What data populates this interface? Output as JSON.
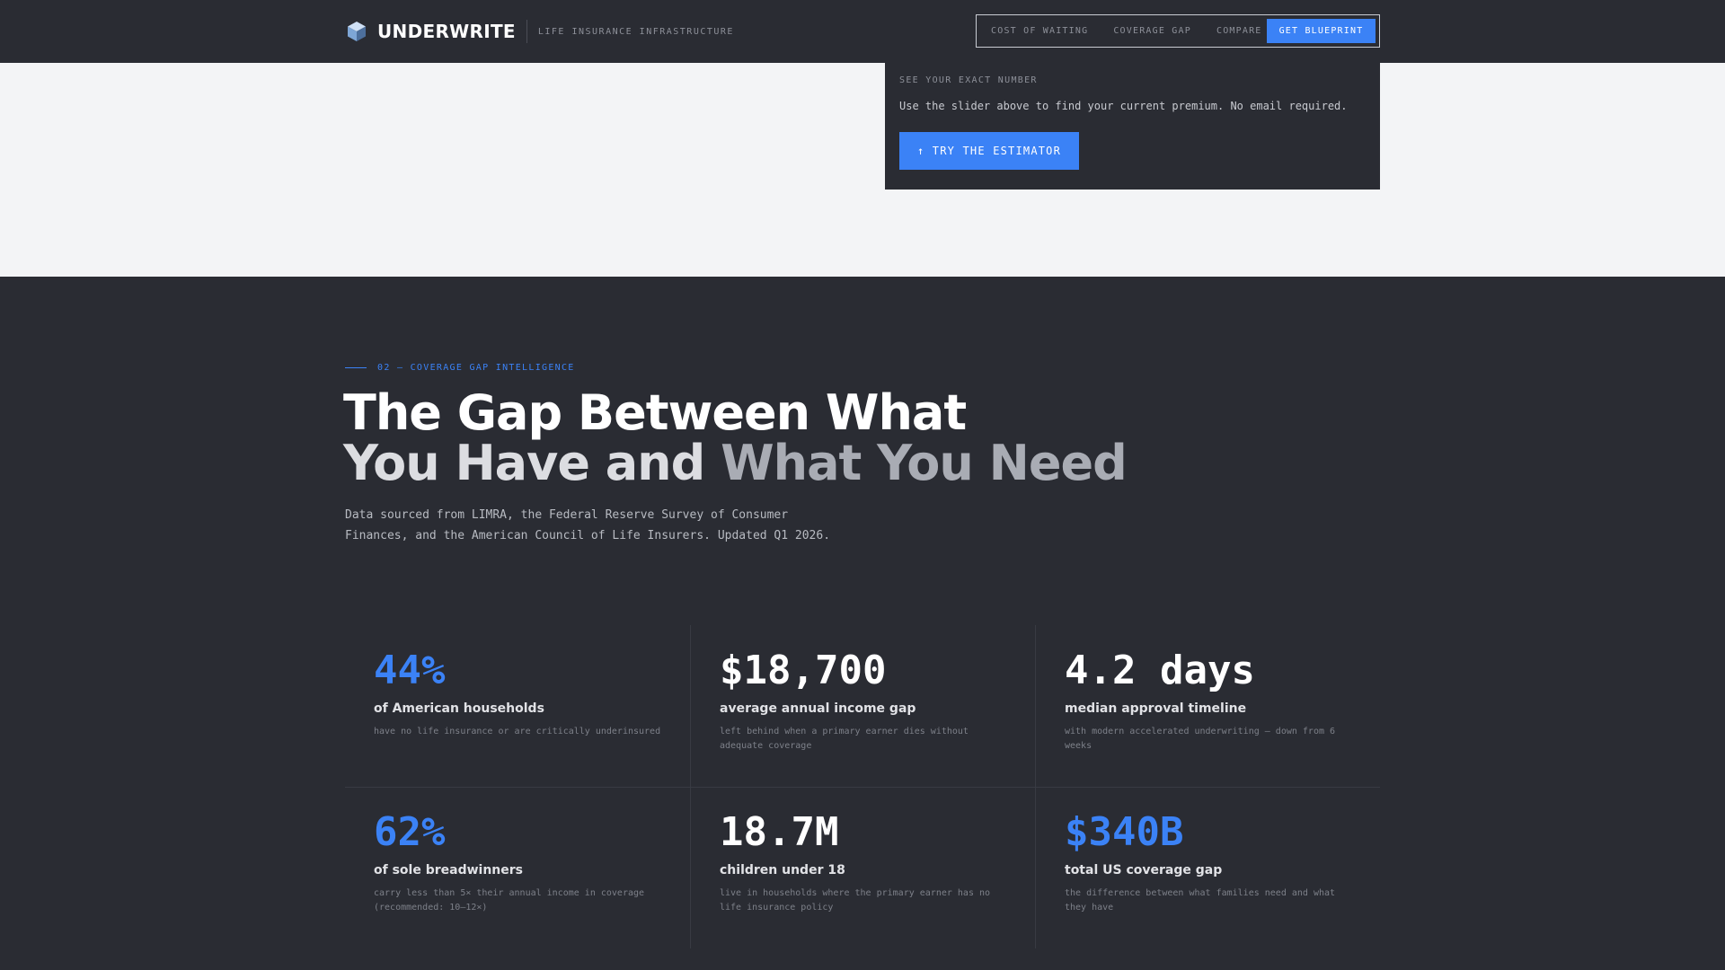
{
  "header": {
    "brand": "UNDERWRITE",
    "tagline": "LIFE INSURANCE INFRASTRUCTURE",
    "nav": [
      "COST OF WAITING",
      "COVERAGE GAP",
      "COMPARE"
    ],
    "cta": "GET BLUEPRINT"
  },
  "estimator_card": {
    "kicker": "SEE YOUR EXACT NUMBER",
    "text": "Use the slider above to find your current premium. No email required.",
    "button": "↑ TRY THE ESTIMATOR"
  },
  "gap_section": {
    "eyebrow": "02 — COVERAGE GAP INTELLIGENCE",
    "headline_line1": "The Gap Between What",
    "headline_line2_a": "You Have and ",
    "headline_line2_b": "What You Need",
    "intro": "Data sourced from LIMRA, the Federal Reserve Survey of Consumer Finances, and the American Council of Life Insurers. Updated Q1 2026.",
    "stats": [
      {
        "value": "44%",
        "label": "of American households",
        "desc": "have no life insurance or are critically underinsured"
      },
      {
        "value": "$18,700",
        "label": "average annual income gap",
        "desc": "left behind when a primary earner dies without adequate coverage"
      },
      {
        "value": "4.2 days",
        "label": "median approval timeline",
        "desc": "with modern accelerated underwriting — down from 6 weeks"
      },
      {
        "value": "62%",
        "label": "of sole breadwinners",
        "desc": "carry less than 5× their annual income in coverage (recommended: 10–12×)"
      },
      {
        "value": "18.7M",
        "label": "children under 18",
        "desc": "live in households where the primary earner has no life insurance policy"
      },
      {
        "value": "$340B",
        "label": "total US coverage gap",
        "desc": "the difference between what families need and what they have"
      }
    ]
  },
  "colors": {
    "accent": "#3b82f6",
    "dark_bg": "#2a2c33",
    "light_bg": "#f3f4f6"
  }
}
